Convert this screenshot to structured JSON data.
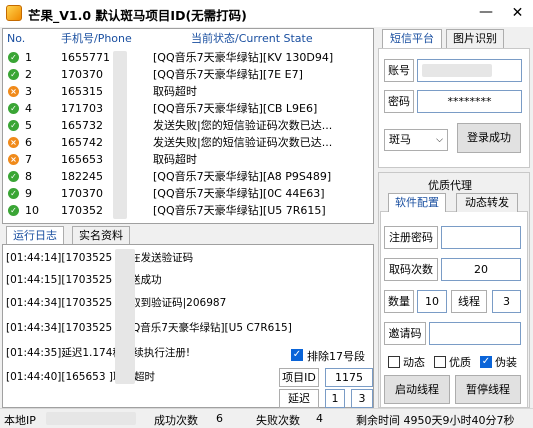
{
  "window": {
    "title": "芒果_V1.0 默认斑马项目ID(无需打码)",
    "minimize": "—",
    "close": "✕"
  },
  "list": {
    "headers": {
      "no": "No.",
      "phone": "手机号/Phone",
      "state": "当前状态/Current State"
    },
    "rows": [
      {
        "no": "1",
        "phone": "1655771",
        "state": "[QQ音乐7天豪华绿钻][KV   130D94]",
        "icon": "ok"
      },
      {
        "no": "2",
        "phone": "170370",
        "state": "[QQ音乐7天豪华绿钻][7E        E7]",
        "icon": "ok"
      },
      {
        "no": "3",
        "phone": "165315",
        "state": "取码超时",
        "icon": "err"
      },
      {
        "no": "4",
        "phone": "171703",
        "state": "[QQ音乐7天豪华绿钻][CB     L9E6]",
        "icon": "ok"
      },
      {
        "no": "5",
        "phone": "165732",
        "state": "发送失败|您的短信验证码次数已达...",
        "icon": "ok"
      },
      {
        "no": "6",
        "phone": "165742",
        "state": "发送失败|您的短信验证码次数已达...",
        "icon": "err"
      },
      {
        "no": "7",
        "phone": "165653",
        "state": "取码超时",
        "icon": "err"
      },
      {
        "no": "8",
        "phone": "182245",
        "state": "[QQ音乐7天豪华绿钻][A8     P9S489]",
        "icon": "ok"
      },
      {
        "no": "9",
        "phone": "170370",
        "state": "[QQ音乐7天豪华绿钻][0C     44E63]",
        "icon": "ok"
      },
      {
        "no": "10",
        "phone": "170352",
        "state": "[QQ音乐7天豪华绿钻][U5     7R615]",
        "icon": "ok"
      }
    ]
  },
  "tabs": {
    "log": "运行日志",
    "realname": "实名资料",
    "sms": "短信平台",
    "image": "图片识别",
    "software": "软件配置",
    "dynamic": "动态转发"
  },
  "log": [
    "[01:44:14][1703525    ]正在发送验证码",
    "[01:44:15][1703525    ]发送成功",
    "[01:44:34][1703525    ]获取到验证码|206987",
    "[01:44:34][1703525    ][QQ音乐7天豪华绿钻][U5     C7R615]",
    "[01:44:35]延迟1.174秒继续执行注册!",
    "[01:44:40][165653     ]取码超时"
  ],
  "sms": {
    "account_label": "账号",
    "password_label": "密码",
    "password_value": "********",
    "platform": "斑马",
    "login_button": "登录成功"
  },
  "config": {
    "section_title": "优质代理",
    "reg_password_label": "注册密码",
    "reg_password_value": "",
    "fetch_count_label": "取码次数",
    "fetch_count_value": "20",
    "qty_label": "数量",
    "qty_value": "10",
    "thread_label": "线程",
    "thread_value": "3",
    "invite_label": "邀请码",
    "invite_value": "",
    "dynamic_label": "动态",
    "quality_label": "优质",
    "fake_label": "伪装",
    "start_button": "启动线程",
    "pause_button": "暂停线程"
  },
  "exclude": {
    "label": "排除17号段",
    "checked": true
  },
  "project": {
    "label": "项目ID",
    "value": "1175",
    "delay_label": "延迟",
    "delay_min": "1",
    "delay_max": "3"
  },
  "status": {
    "local_ip": "本地IP",
    "success_label": "成功次数",
    "success_value": "6",
    "fail_label": "失败次数",
    "fail_value": "4",
    "remaining": "剩余时间  4950天9小时40分7秒"
  }
}
